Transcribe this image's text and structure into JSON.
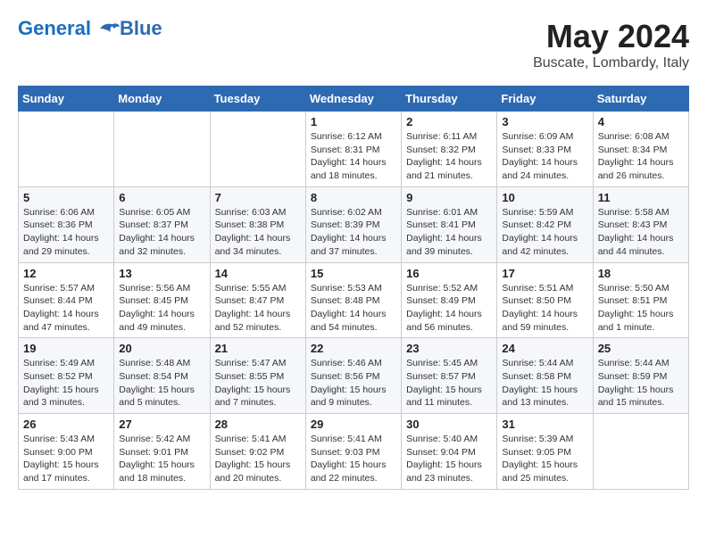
{
  "logo": {
    "line1": "General",
    "line2": "Blue"
  },
  "title": "May 2024",
  "subtitle": "Buscate, Lombardy, Italy",
  "weekdays": [
    "Sunday",
    "Monday",
    "Tuesday",
    "Wednesday",
    "Thursday",
    "Friday",
    "Saturday"
  ],
  "weeks": [
    [
      {
        "day": "",
        "info": ""
      },
      {
        "day": "",
        "info": ""
      },
      {
        "day": "",
        "info": ""
      },
      {
        "day": "1",
        "info": "Sunrise: 6:12 AM\nSunset: 8:31 PM\nDaylight: 14 hours\nand 18 minutes."
      },
      {
        "day": "2",
        "info": "Sunrise: 6:11 AM\nSunset: 8:32 PM\nDaylight: 14 hours\nand 21 minutes."
      },
      {
        "day": "3",
        "info": "Sunrise: 6:09 AM\nSunset: 8:33 PM\nDaylight: 14 hours\nand 24 minutes."
      },
      {
        "day": "4",
        "info": "Sunrise: 6:08 AM\nSunset: 8:34 PM\nDaylight: 14 hours\nand 26 minutes."
      }
    ],
    [
      {
        "day": "5",
        "info": "Sunrise: 6:06 AM\nSunset: 8:36 PM\nDaylight: 14 hours\nand 29 minutes."
      },
      {
        "day": "6",
        "info": "Sunrise: 6:05 AM\nSunset: 8:37 PM\nDaylight: 14 hours\nand 32 minutes."
      },
      {
        "day": "7",
        "info": "Sunrise: 6:03 AM\nSunset: 8:38 PM\nDaylight: 14 hours\nand 34 minutes."
      },
      {
        "day": "8",
        "info": "Sunrise: 6:02 AM\nSunset: 8:39 PM\nDaylight: 14 hours\nand 37 minutes."
      },
      {
        "day": "9",
        "info": "Sunrise: 6:01 AM\nSunset: 8:41 PM\nDaylight: 14 hours\nand 39 minutes."
      },
      {
        "day": "10",
        "info": "Sunrise: 5:59 AM\nSunset: 8:42 PM\nDaylight: 14 hours\nand 42 minutes."
      },
      {
        "day": "11",
        "info": "Sunrise: 5:58 AM\nSunset: 8:43 PM\nDaylight: 14 hours\nand 44 minutes."
      }
    ],
    [
      {
        "day": "12",
        "info": "Sunrise: 5:57 AM\nSunset: 8:44 PM\nDaylight: 14 hours\nand 47 minutes."
      },
      {
        "day": "13",
        "info": "Sunrise: 5:56 AM\nSunset: 8:45 PM\nDaylight: 14 hours\nand 49 minutes."
      },
      {
        "day": "14",
        "info": "Sunrise: 5:55 AM\nSunset: 8:47 PM\nDaylight: 14 hours\nand 52 minutes."
      },
      {
        "day": "15",
        "info": "Sunrise: 5:53 AM\nSunset: 8:48 PM\nDaylight: 14 hours\nand 54 minutes."
      },
      {
        "day": "16",
        "info": "Sunrise: 5:52 AM\nSunset: 8:49 PM\nDaylight: 14 hours\nand 56 minutes."
      },
      {
        "day": "17",
        "info": "Sunrise: 5:51 AM\nSunset: 8:50 PM\nDaylight: 14 hours\nand 59 minutes."
      },
      {
        "day": "18",
        "info": "Sunrise: 5:50 AM\nSunset: 8:51 PM\nDaylight: 15 hours\nand 1 minute."
      }
    ],
    [
      {
        "day": "19",
        "info": "Sunrise: 5:49 AM\nSunset: 8:52 PM\nDaylight: 15 hours\nand 3 minutes."
      },
      {
        "day": "20",
        "info": "Sunrise: 5:48 AM\nSunset: 8:54 PM\nDaylight: 15 hours\nand 5 minutes."
      },
      {
        "day": "21",
        "info": "Sunrise: 5:47 AM\nSunset: 8:55 PM\nDaylight: 15 hours\nand 7 minutes."
      },
      {
        "day": "22",
        "info": "Sunrise: 5:46 AM\nSunset: 8:56 PM\nDaylight: 15 hours\nand 9 minutes."
      },
      {
        "day": "23",
        "info": "Sunrise: 5:45 AM\nSunset: 8:57 PM\nDaylight: 15 hours\nand 11 minutes."
      },
      {
        "day": "24",
        "info": "Sunrise: 5:44 AM\nSunset: 8:58 PM\nDaylight: 15 hours\nand 13 minutes."
      },
      {
        "day": "25",
        "info": "Sunrise: 5:44 AM\nSunset: 8:59 PM\nDaylight: 15 hours\nand 15 minutes."
      }
    ],
    [
      {
        "day": "26",
        "info": "Sunrise: 5:43 AM\nSunset: 9:00 PM\nDaylight: 15 hours\nand 17 minutes."
      },
      {
        "day": "27",
        "info": "Sunrise: 5:42 AM\nSunset: 9:01 PM\nDaylight: 15 hours\nand 18 minutes."
      },
      {
        "day": "28",
        "info": "Sunrise: 5:41 AM\nSunset: 9:02 PM\nDaylight: 15 hours\nand 20 minutes."
      },
      {
        "day": "29",
        "info": "Sunrise: 5:41 AM\nSunset: 9:03 PM\nDaylight: 15 hours\nand 22 minutes."
      },
      {
        "day": "30",
        "info": "Sunrise: 5:40 AM\nSunset: 9:04 PM\nDaylight: 15 hours\nand 23 minutes."
      },
      {
        "day": "31",
        "info": "Sunrise: 5:39 AM\nSunset: 9:05 PM\nDaylight: 15 hours\nand 25 minutes."
      },
      {
        "day": "",
        "info": ""
      }
    ]
  ]
}
